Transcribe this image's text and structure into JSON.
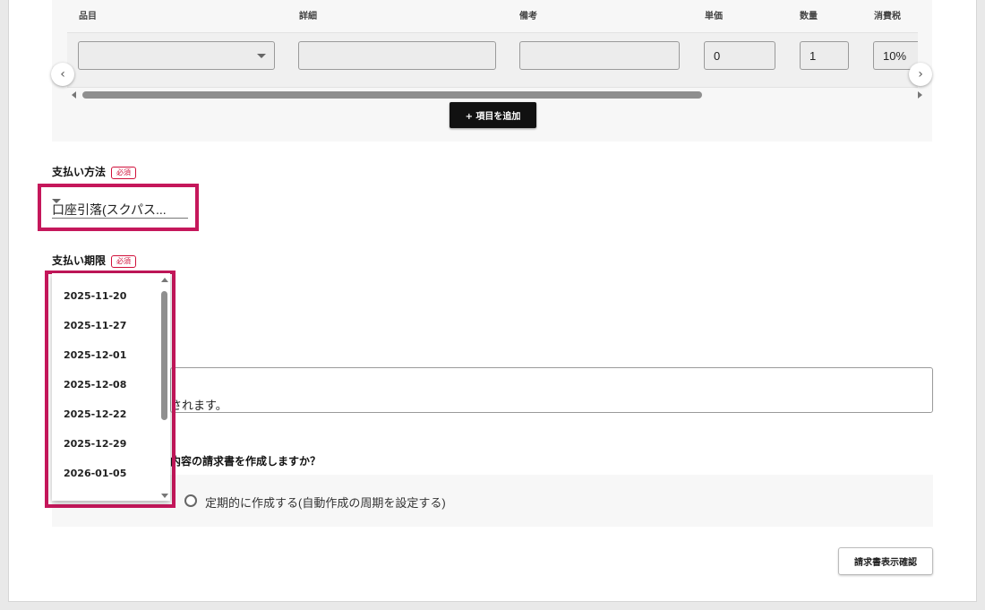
{
  "items_table": {
    "columns": [
      "品目",
      "詳細",
      "備考",
      "単価",
      "数量",
      "消費税"
    ],
    "row": {
      "item": "",
      "detail": "",
      "note": "",
      "unit_price": "0",
      "quantity": "1",
      "tax": "10%"
    },
    "prev_label": "‹",
    "next_label": "›",
    "add_label": "+ 項目を追加"
  },
  "payment_method": {
    "label": "支払い方法",
    "required": "必須",
    "value": "口座引落(スクパス..."
  },
  "payment_due": {
    "label": "支払い期限",
    "required": "必須",
    "options": [
      "2025-11-20",
      "2025-11-27",
      "2025-12-01",
      "2025-12-08",
      "2025-12-22",
      "2025-12-29",
      "2026-01-05"
    ]
  },
  "notice": {
    "text": "されます。"
  },
  "recurring": {
    "question": "内容の請求書を作成しますか？",
    "option_recurring": "定期的に作成する(自動作成の周期を設定する)"
  },
  "confirm_label": "請求書表示確認",
  "colors": {
    "highlight": "#c5175b",
    "required": "#d0103a",
    "add_button": "#111111"
  }
}
